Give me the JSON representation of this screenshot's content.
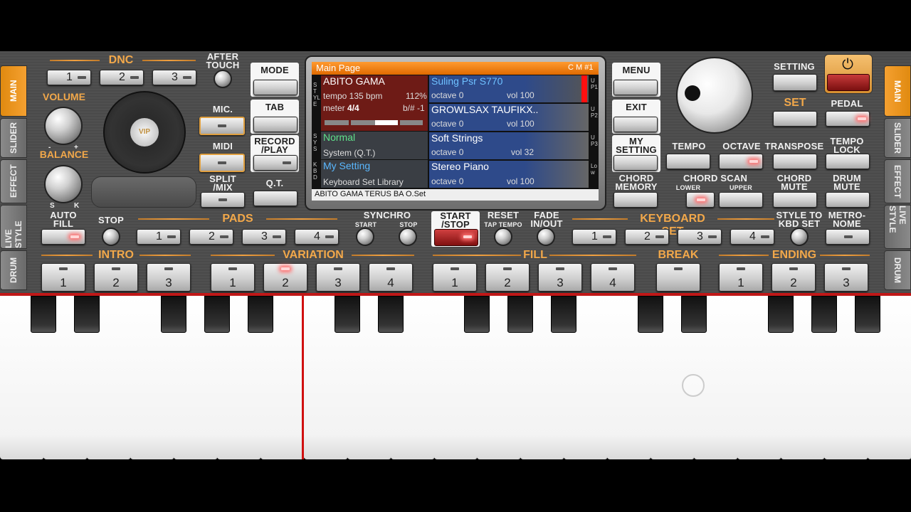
{
  "left_tabs": [
    "MAIN",
    "SLIDER",
    "EFFECT",
    "LIVE STYLE",
    "DRUM"
  ],
  "right_tabs": [
    "MAIN",
    "SLIDER",
    "EFFECT",
    "LIVE STYLE",
    "DRUM"
  ],
  "dnc": {
    "label": "DNC",
    "buttons": [
      "1",
      "2",
      "3"
    ]
  },
  "after_touch": "AFTER TOUCH",
  "volume": {
    "label": "VOLUME",
    "minus": "-",
    "plus": "+"
  },
  "balance": {
    "label": "BALANCE",
    "s": "S",
    "k": "K"
  },
  "disc_logo": "VIP",
  "left_buttons": {
    "mic": "MIC.",
    "midi": "MIDI",
    "split": "SPLIT /MIX"
  },
  "center_left_buttons": {
    "mode": "MODE",
    "tab": "TAB",
    "record": "RECORD /PLAY",
    "qt": "Q.T."
  },
  "center_right_buttons": {
    "menu": "MENU",
    "exit": "EXIT",
    "my_setting": "MY SETTING",
    "chord_memory": "CHORD MEMORY"
  },
  "display": {
    "header": "Main Page",
    "header_right": "C M #1",
    "side_labels": {
      "style": "STYLE",
      "sys": "SYS",
      "kbd": "KBD",
      "up1": "UP1",
      "up2": "UP2",
      "up3": "UP3",
      "low": "Low"
    },
    "style": {
      "name": "ABITO GAMA",
      "tempo": "tempo 135 bpm",
      "percent": "112%",
      "meter_label": "meter",
      "meter": "4/4",
      "key": "b/# -1"
    },
    "sys": {
      "name": "Normal",
      "sub": "System (Q.T.)"
    },
    "kbd": {
      "name": "My Setting",
      "sub": "Keyboard Set Library"
    },
    "voices": [
      {
        "name": "Suling Psr S770",
        "octave": "octave  0",
        "vol": "vol 100"
      },
      {
        "name": "GROWLSAX TAUFIKX..",
        "octave": "octave  0",
        "vol": "vol 100"
      },
      {
        "name": "Soft Strings",
        "octave": "octave  0",
        "vol": "vol 32"
      },
      {
        "name": "Stereo Piano",
        "octave": "octave  0",
        "vol": "vol 100"
      }
    ],
    "footer": "ABITO GAMA TERUS BA O.Set"
  },
  "right_panel": {
    "setting": "SETTING",
    "set": "SET",
    "pedal": "PEDAL",
    "tempo": "TEMPO",
    "octave": "OCTAVE",
    "transpose": "TRANSPOSE",
    "tempo_lock": "TEMPO LOCK",
    "chord_scan": "CHORD SCAN",
    "lower": "LOWER",
    "upper": "UPPER",
    "chord_mute": "CHORD MUTE",
    "drum_mute": "DRUM MUTE",
    "power_icon": "power-icon"
  },
  "row2": {
    "auto_fill": "AUTO FILL",
    "stop": "STOP",
    "pads": "PADS",
    "pad_buttons": [
      "1",
      "2",
      "3",
      "4"
    ],
    "synchro": "SYNCHRO",
    "synchro_start": "START",
    "synchro_stop": "STOP",
    "start_stop": "START /STOP",
    "reset": "RESET",
    "tap_tempo": "TAP TEMPO",
    "fade": "FADE IN/OUT",
    "keyboard_set": "KEYBOARD SET",
    "kbd_buttons": [
      "1",
      "2",
      "3",
      "4"
    ],
    "style_to_kbd": "STYLE TO KBD SET",
    "metronome": "METRO- NOME"
  },
  "row3": {
    "intro": "INTRO",
    "intro_buttons": [
      "1",
      "2",
      "3"
    ],
    "variation": "VARIATION",
    "variation_buttons": [
      "1",
      "2",
      "3",
      "4"
    ],
    "fill": "FILL",
    "fill_buttons": [
      "1",
      "2",
      "3",
      "4"
    ],
    "break": "BREAK",
    "ending": "ENDING",
    "ending_buttons": [
      "1",
      "2",
      "3"
    ]
  },
  "colors": {
    "accent": "#f2a84a",
    "display_header": "#f07a10",
    "style_bg": "#7a1f1a",
    "voice_bg": "#2e4a8a",
    "led": "#ff6a6a"
  }
}
